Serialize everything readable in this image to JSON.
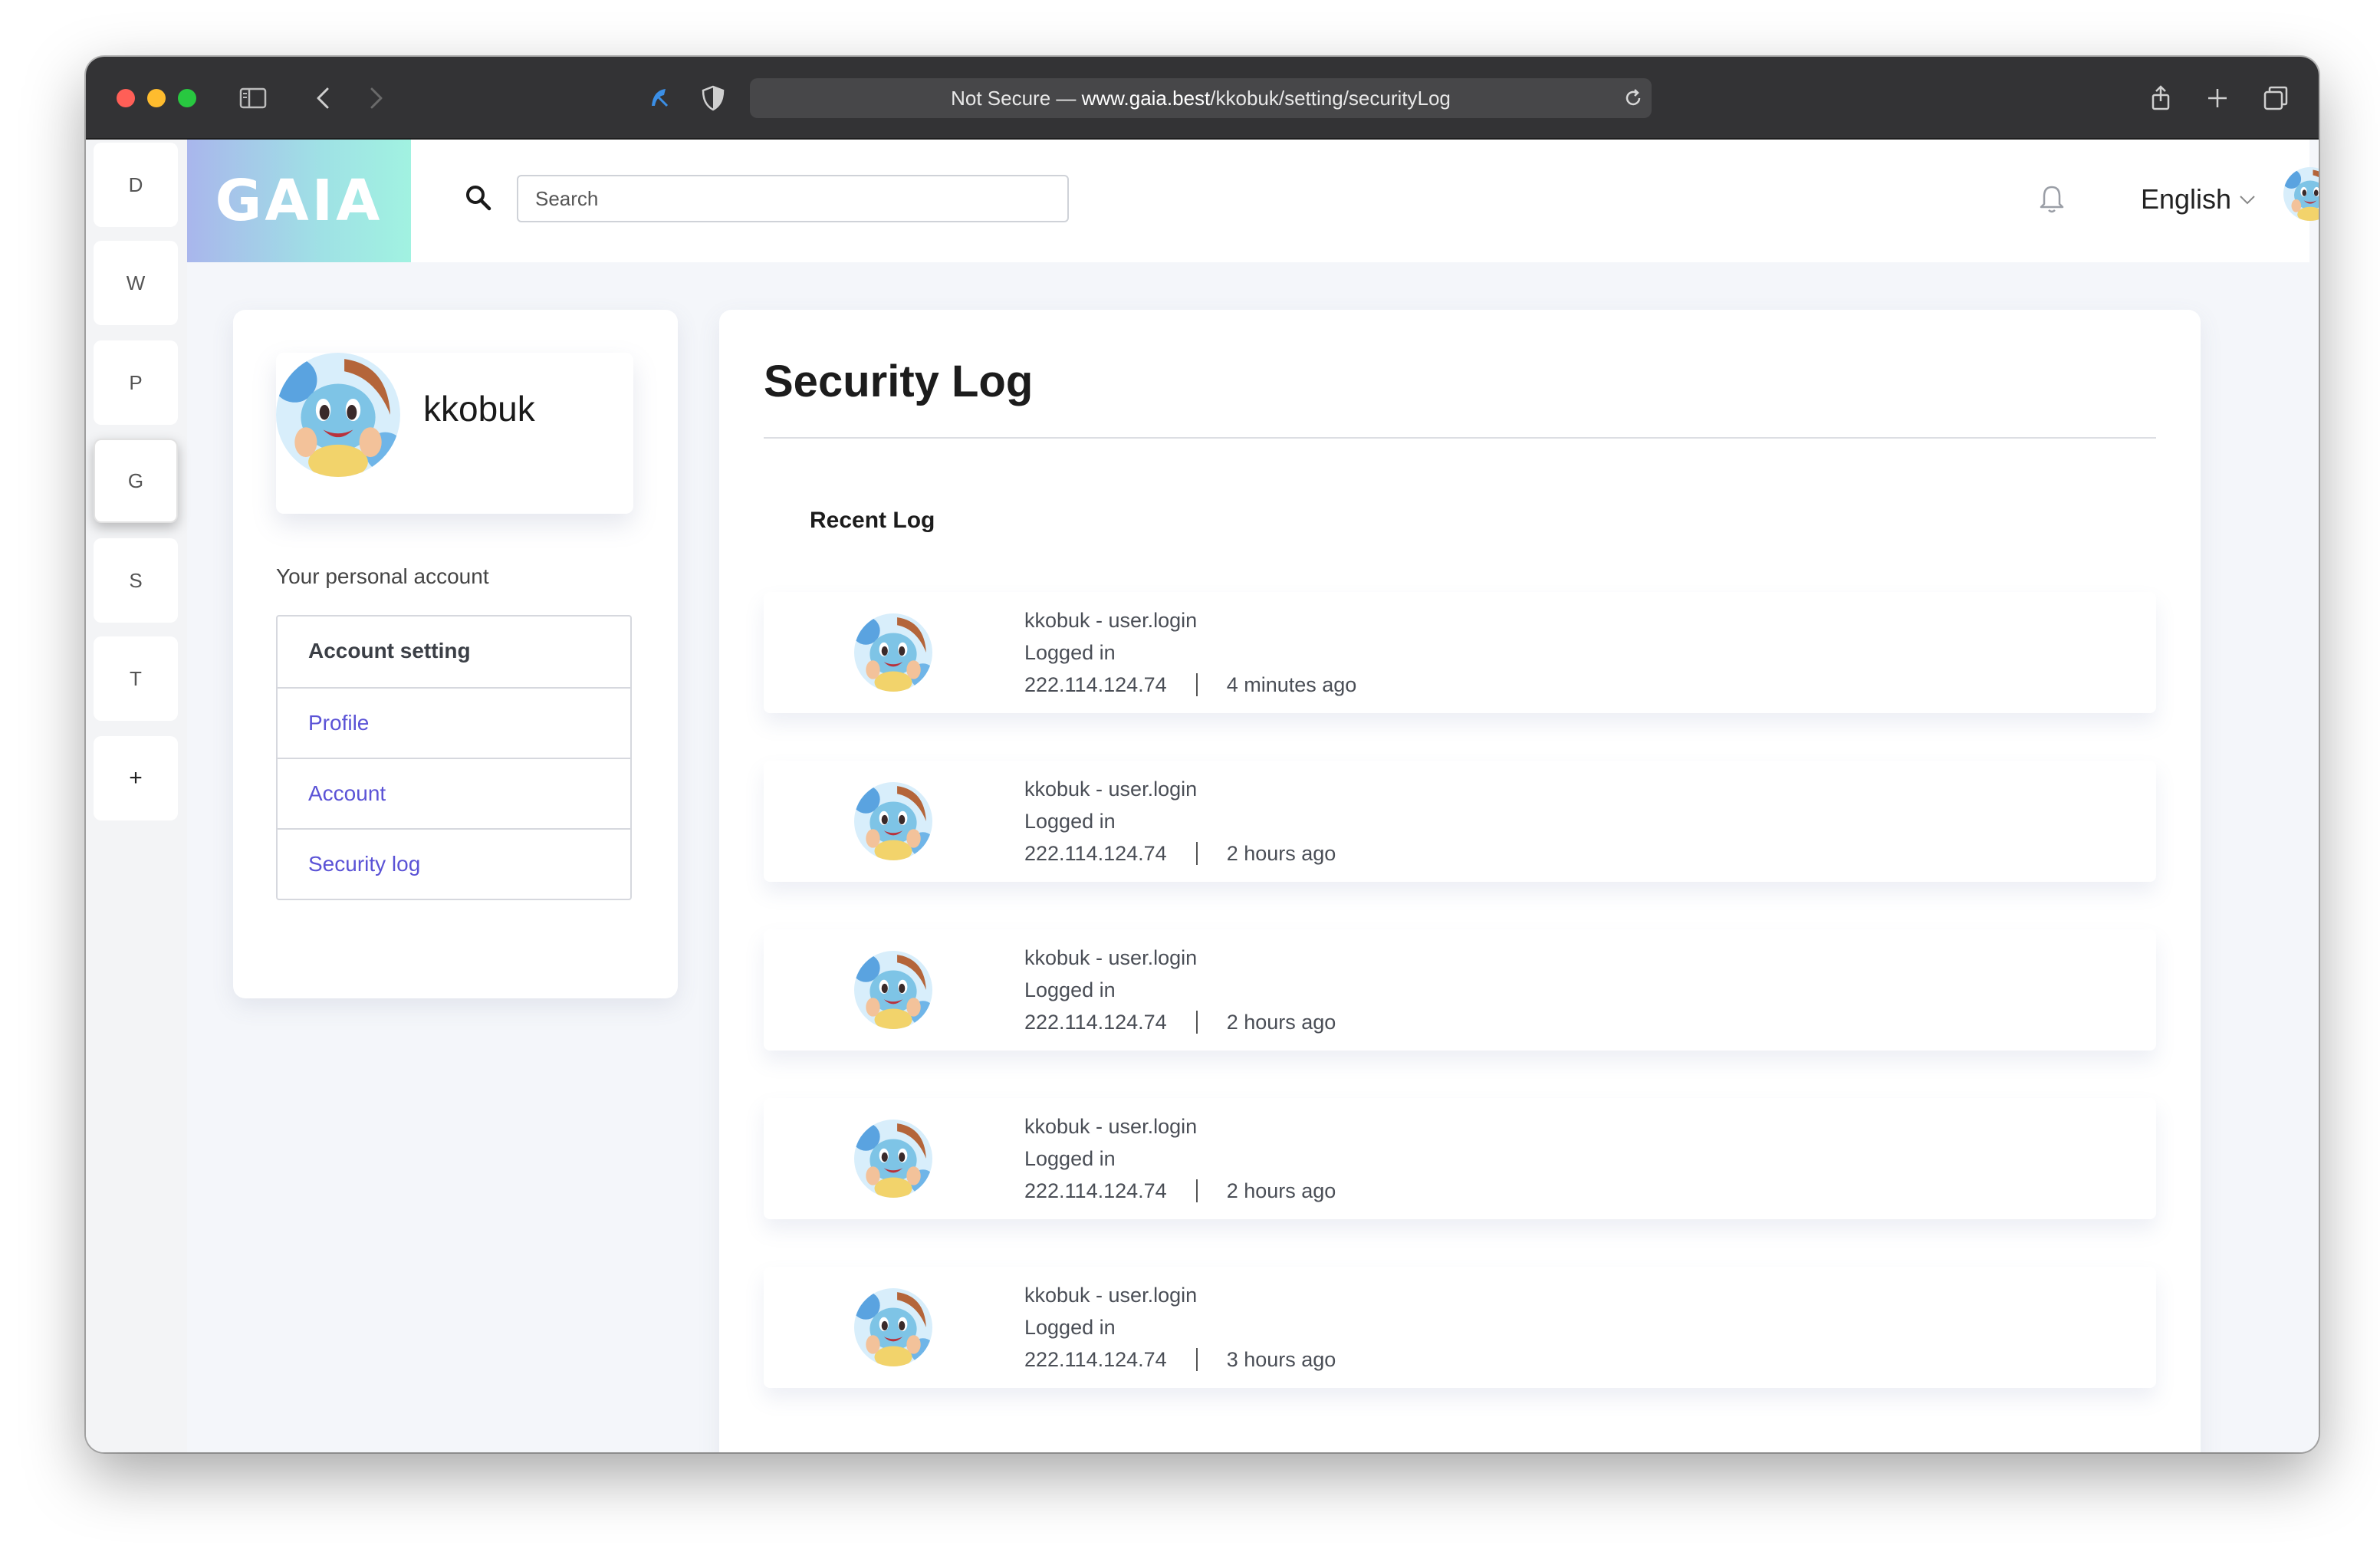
{
  "browser": {
    "url_prefix": "Not Secure — ",
    "url_host": "www.gaia.best",
    "url_path": "/kkobuk/setting/securityLog"
  },
  "rail": {
    "items": [
      {
        "label": "D"
      },
      {
        "label": "W"
      },
      {
        "label": "P"
      },
      {
        "label": "G"
      },
      {
        "label": "S"
      },
      {
        "label": "T"
      },
      {
        "label": "+"
      }
    ],
    "active_index": 3
  },
  "header": {
    "logo": "GAIA",
    "search_placeholder": "Search",
    "language": "English"
  },
  "profile": {
    "username": "kkobuk",
    "personal_label": "Your personal account"
  },
  "menu": {
    "header": "Account setting",
    "items": [
      {
        "label": "Profile"
      },
      {
        "label": "Account"
      },
      {
        "label": "Security log"
      }
    ]
  },
  "main": {
    "title": "Security Log",
    "section_title": "Recent Log"
  },
  "logs": [
    {
      "action": "kkobuk - user.login",
      "description": "Logged in",
      "ip": "222.114.124.74",
      "time": "4 minutes ago"
    },
    {
      "action": "kkobuk - user.login",
      "description": "Logged in",
      "ip": "222.114.124.74",
      "time": "2 hours ago"
    },
    {
      "action": "kkobuk - user.login",
      "description": "Logged in",
      "ip": "222.114.124.74",
      "time": "2 hours ago"
    },
    {
      "action": "kkobuk - user.login",
      "description": "Logged in",
      "ip": "222.114.124.74",
      "time": "2 hours ago"
    },
    {
      "action": "kkobuk - user.login",
      "description": "Logged in",
      "ip": "222.114.124.74",
      "time": "3 hours ago"
    }
  ],
  "colors": {
    "accent": "#5b53d6",
    "status_dot": "#f38b3c"
  }
}
